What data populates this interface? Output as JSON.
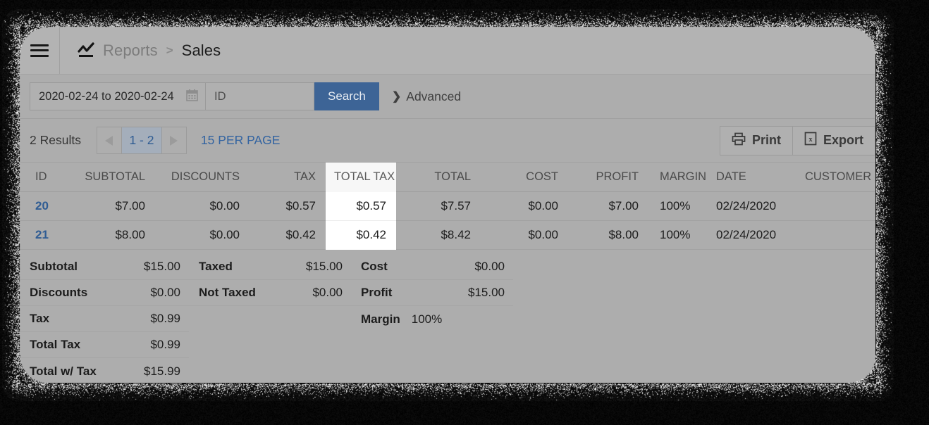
{
  "window": {
    "topbar": {
      "menu_icon": "hamburger-icon",
      "breadcrumb": {
        "icon": "line-chart-icon",
        "parent": "Reports",
        "separator": ">",
        "current": "Sales"
      }
    },
    "searchbar": {
      "date_range": "2020-02-24 to 2020-02-24",
      "date_icon": "calendar-icon",
      "id_placeholder": "ID",
      "id_value": "",
      "search_label": "Search",
      "advanced_label": "Advanced",
      "advanced_icon": "chevron-right-icon"
    },
    "resultsbar": {
      "results_count": "2 Results",
      "prev_icon": "triangle-left-icon",
      "page_label": "1 - 2",
      "next_icon": "triangle-right-icon",
      "per_page_label": "15 PER PAGE",
      "print_label": "Print",
      "print_icon": "printer-icon",
      "export_label": "Export",
      "export_icon": "excel-file-icon"
    },
    "table": {
      "columns": [
        "ID",
        "SUBTOTAL",
        "DISCOUNTS",
        "TAX",
        "TOTAL TAX",
        "TOTAL",
        "COST",
        "PROFIT",
        "MARGIN",
        "DATE",
        "CUSTOMER"
      ],
      "highlighted_column": "TOTAL TAX",
      "rows": [
        {
          "id": "20",
          "subtotal": "$7.00",
          "discounts": "$0.00",
          "tax": "$0.57",
          "total_tax": "$0.57",
          "total": "$7.57",
          "cost": "$0.00",
          "profit": "$7.00",
          "margin": "100%",
          "date": "02/24/2020",
          "customer": ""
        },
        {
          "id": "21",
          "subtotal": "$8.00",
          "discounts": "$0.00",
          "tax": "$0.42",
          "total_tax": "$0.42",
          "total": "$8.42",
          "cost": "$0.00",
          "profit": "$8.00",
          "margin": "100%",
          "date": "02/24/2020",
          "customer": ""
        }
      ]
    },
    "summary": {
      "col1": [
        {
          "label": "Subtotal",
          "value": "$15.00"
        },
        {
          "label": "Discounts",
          "value": "$0.00"
        },
        {
          "label": "Tax",
          "value": "$0.99"
        },
        {
          "label": "Total Tax",
          "value": "$0.99"
        },
        {
          "label": "Total w/ Tax",
          "value": "$15.99"
        }
      ],
      "col2": [
        {
          "label": "Taxed",
          "value": "$15.00"
        },
        {
          "label": "Not Taxed",
          "value": "$0.00"
        }
      ],
      "col3": [
        {
          "label": "Cost",
          "value": "$0.00"
        },
        {
          "label": "Profit",
          "value": "$15.00"
        },
        {
          "label": "Margin",
          "value": "100%"
        }
      ]
    }
  },
  "colors": {
    "accent_blue": "#3d6496",
    "link_blue": "#2f5c93",
    "window_bg": "#adadad",
    "topbar_bg": "#b3b3b3",
    "highlight_col": "#ffffff"
  }
}
